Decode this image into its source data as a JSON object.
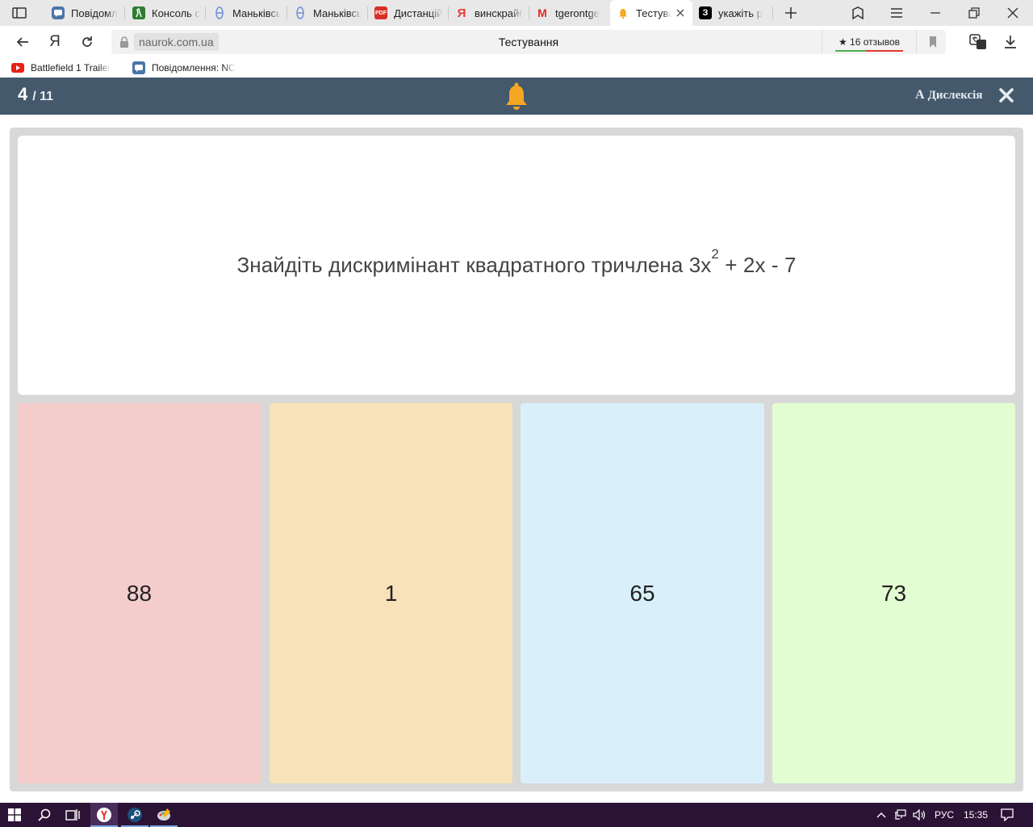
{
  "browser": {
    "tabs": [
      {
        "label": "Повідомл",
        "icon": "chat-icon",
        "active": false
      },
      {
        "label": "Консоль с",
        "icon": "counter-strike-icon",
        "active": false
      },
      {
        "label": "Маньківсь",
        "icon": "school-icon",
        "active": false
      },
      {
        "label": "Маньківсь",
        "icon": "school-icon",
        "active": false
      },
      {
        "label": "Дистанцій",
        "icon": "pdf-icon",
        "active": false
      },
      {
        "label": "винскрайб",
        "icon": "yandex-icon",
        "active": false
      },
      {
        "label": "tgerontge",
        "icon": "gmail-icon",
        "active": false
      },
      {
        "label": "Тестува",
        "icon": "bell-icon",
        "active": true
      },
      {
        "label": "укажіть р",
        "icon": "znanija-icon",
        "active": false
      }
    ],
    "pdf_badge": "PDF",
    "yandex_letter": "Я",
    "gmail_letter": "M",
    "znanija_letter": "З",
    "url_domain": "naurok.com.ua",
    "page_title": "Тестування",
    "reviews": "★ 16 отзывов",
    "bookmarks": [
      {
        "label": "Battlefield 1 Trailer",
        "icon": "youtube-icon"
      },
      {
        "label": "Повідомлення: NC",
        "icon": "chat-icon"
      }
    ]
  },
  "quiz": {
    "current": "4",
    "total": "/ 11",
    "dyslexia_icon": "A",
    "dyslexia_label": "Дислексія",
    "question": {
      "before": "Знайдіть дискримінант квадратного тричлена 3x",
      "sup": "2",
      "after": " + 2x - 7"
    },
    "answers": [
      {
        "text": "88",
        "color": "#f5cccc"
      },
      {
        "text": "1",
        "color": "#f8e2b9"
      },
      {
        "text": "65",
        "color": "#d9f0fa"
      },
      {
        "text": "73",
        "color": "#e1fdd1"
      }
    ]
  },
  "colors": {
    "header": "#44596b",
    "bell": "#f5a623",
    "taskbar": "#2b1336"
  },
  "taskbar": {
    "lang": "РУС",
    "time": "15:35"
  }
}
